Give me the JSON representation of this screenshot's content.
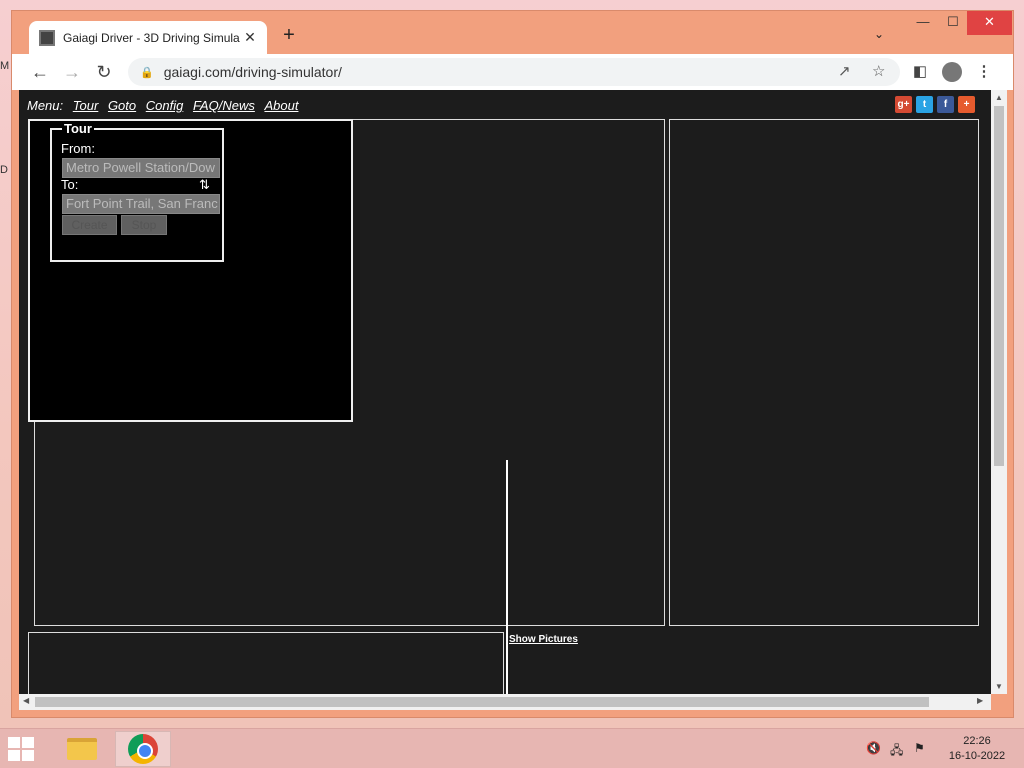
{
  "browser": {
    "tab_title": "Gaiagi Driver - 3D Driving Simula",
    "tab_close": "✕",
    "new_tab": "+",
    "url": "gaiagi.com/driving-simulator/",
    "window_controls": {
      "minimize": "—",
      "maximize": "☐",
      "close": "✕"
    }
  },
  "page": {
    "menu_label": "Menu:",
    "menu_items": [
      "Tour",
      "Goto",
      "Config",
      "FAQ/News",
      "About"
    ],
    "social": [
      "g+",
      "t",
      "f",
      "+"
    ],
    "tour": {
      "legend": "Tour",
      "from_label": "From:",
      "from_value": "Metro Powell Station/Dow",
      "to_label": "To:",
      "to_value": "Fort Point Trail, San Franc",
      "create_label": "Create",
      "stop_label": "Stop"
    },
    "show_pictures": "Show Pictures"
  },
  "taskbar": {
    "time": "22:26",
    "date": "16-10-2022"
  },
  "desktop_glyphs": [
    "M",
    "D"
  ],
  "colors": {
    "page_background": "#1c1c1c",
    "window_frame": "#f2a07e",
    "taskbar": "#e7b6b2"
  }
}
